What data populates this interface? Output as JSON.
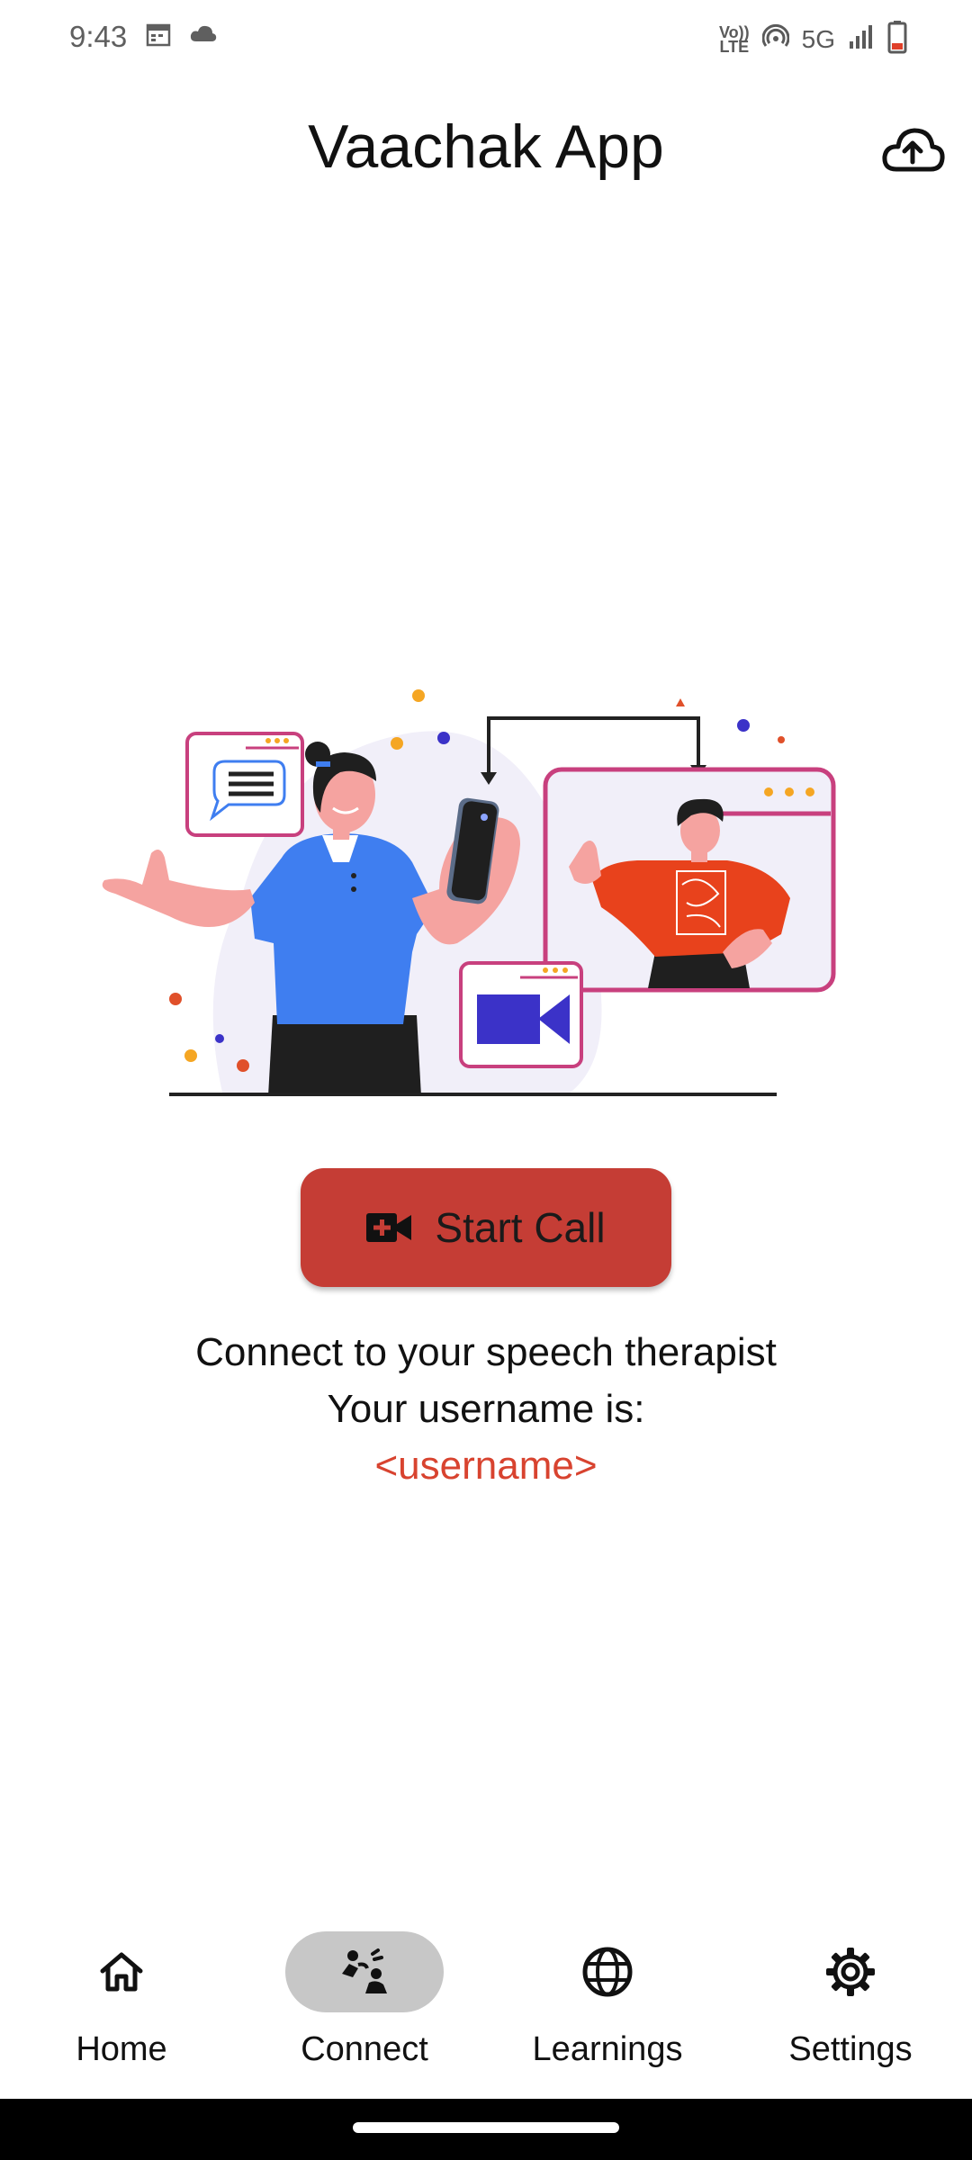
{
  "status_bar": {
    "time": "9:43",
    "left_icons": [
      "calendar-icon",
      "cloud-icon"
    ],
    "right_icons": [
      "volte-icon",
      "hotspot-icon",
      "signal-icon",
      "battery-icon"
    ],
    "volte_top": "Vo))",
    "volte_bottom": "LTE",
    "network": "5G"
  },
  "app_bar": {
    "title": "Vaachak App",
    "action_icon": "cloud-upload-icon"
  },
  "main": {
    "start_call_label": "Start Call",
    "start_call_icon": "video-call-icon",
    "info_line1": "Connect to your speech therapist",
    "info_line2": "Your username is:",
    "username": "<username>"
  },
  "bottom_nav": {
    "items": [
      {
        "label": "Home",
        "icon": "home-icon",
        "active": false
      },
      {
        "label": "Connect",
        "icon": "connect-icon",
        "active": true
      },
      {
        "label": "Learnings",
        "icon": "globe-icon",
        "active": false
      },
      {
        "label": "Settings",
        "icon": "gear-icon",
        "active": false
      }
    ]
  },
  "colors": {
    "accent_button": "#c53d35",
    "username_text": "#d8432f",
    "nav_active_pill": "#c7c7c7",
    "illustration_blue": "#3f7ef0",
    "illustration_magenta": "#c8407e",
    "illustration_orange": "#e8421c"
  }
}
